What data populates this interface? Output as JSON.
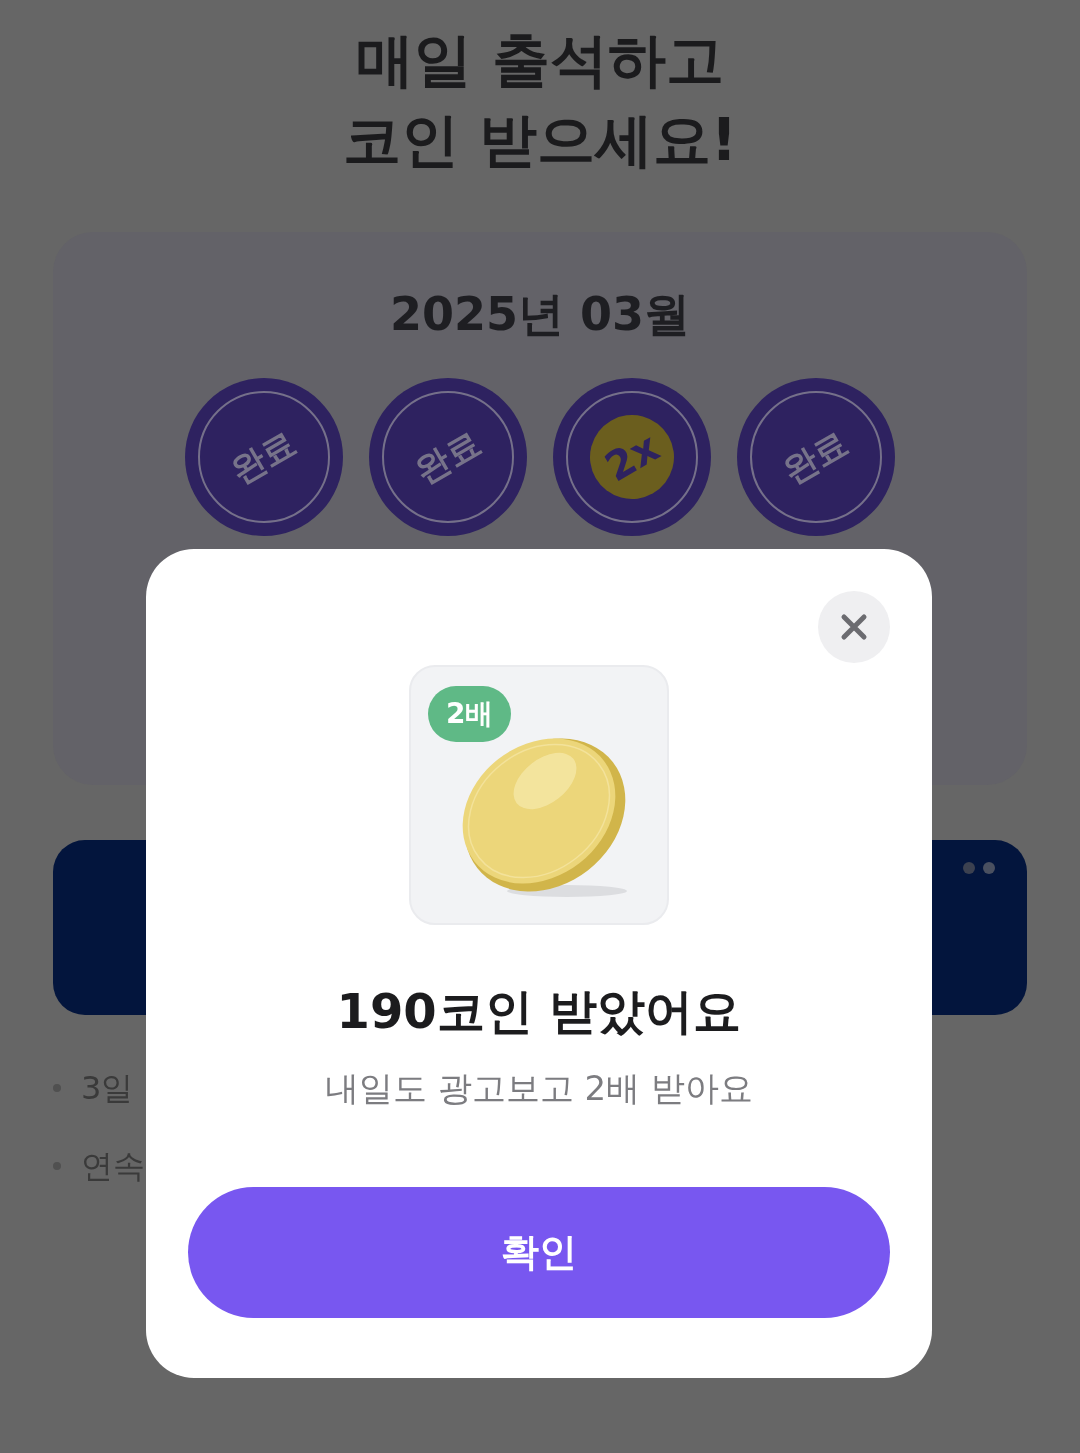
{
  "title_lines": [
    "매일 출석하고",
    "코인 받으세요!"
  ],
  "calendar": {
    "month": "2025년 03월",
    "stamps": [
      {
        "kind": "done",
        "label": "완료"
      },
      {
        "kind": "done",
        "label": "완료"
      },
      {
        "kind": "coin",
        "label": "2x"
      },
      {
        "kind": "done",
        "label": "완료"
      }
    ]
  },
  "notes": [
    "3일",
    "연속"
  ],
  "modal": {
    "badge": "2배",
    "title": "190코인 받았어요",
    "subtitle": "내일도 광고보고 2배 받아요",
    "button": "확인"
  }
}
